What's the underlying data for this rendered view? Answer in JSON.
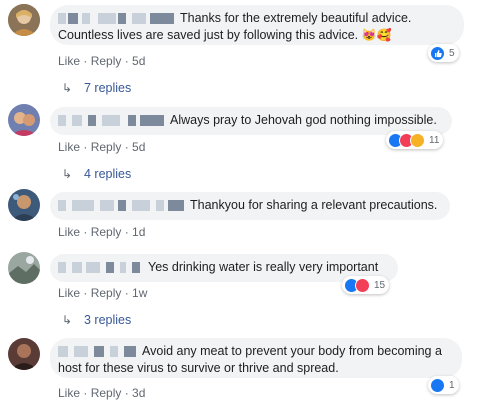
{
  "comments": [
    {
      "text_line1": "Thanks for the extremely beautiful advice.",
      "text_line2": "Countless lives are saved just by following this advice.",
      "emoji": "😻🥰",
      "like": "Like",
      "reply": "Reply",
      "time": "5d",
      "reaction_count": "5",
      "reactions": [
        "like-icon"
      ],
      "replies": "7 replies"
    },
    {
      "text_line1": "Always pray to Jehovah god nothing impossible.",
      "like": "Like",
      "reply": "Reply",
      "time": "5d",
      "reaction_count": "11",
      "reactions": [
        "like-icon",
        "love-icon",
        "haha-icon"
      ],
      "replies": "4 replies"
    },
    {
      "text_line1": "Thankyou for sharing a relevant precautions.",
      "like": "Like",
      "reply": "Reply",
      "time": "1d"
    },
    {
      "text_line1": "Yes drinking water is really very important",
      "like": "Like",
      "reply": "Reply",
      "time": "1w",
      "reaction_count": "15",
      "reactions": [
        "like-icon",
        "love-icon"
      ],
      "replies": "3 replies"
    },
    {
      "text_line1": "Avoid any meat to prevent your body from becoming a",
      "text_line2": "host for these virus to survive or thrive and spread.",
      "like": "Like",
      "reply": "Reply",
      "time": "3d",
      "reaction_count": "1",
      "reactions": [
        "like-icon"
      ]
    }
  ],
  "colors": {
    "bubble": "#f2f3f5",
    "link": "#385898",
    "meta": "#606770",
    "like": "#1877f2",
    "love": "#f33e58"
  }
}
